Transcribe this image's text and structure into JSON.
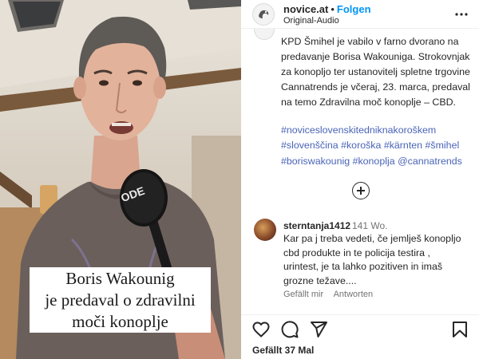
{
  "header": {
    "account": "novice.at",
    "separator": "•",
    "follow_label": "Folgen",
    "audio_label": "Original-Audio"
  },
  "post": {
    "caption": "KPD Šmihel je vabilo v farno dvorano na predavanje Borisa Wakouniga. Strokovnjak za konopljo ter ustanovitelj spletne trgovine Cannatrends je včeraj, 23. marca, predaval na temo Zdravilna moč konoplje – CBD.",
    "hashtags": [
      "#noviceslovenskitedniknakoroškem",
      "#slovenščina",
      "#koroška",
      "#kärnten",
      "#šmihel",
      "#boriswakounig",
      "#konoplja",
      "@cannatrends"
    ]
  },
  "comment": {
    "user": "sterntanja1412",
    "time": "141 Wo.",
    "text": "Kar pa j treba vedeti, če jemlješ konopljo cbd produkte in te policija testira , urintest, je ta lahko pozitiven in imaš grozne težave....",
    "like_label": "Gefällt mir",
    "reply_label": "Antworten"
  },
  "video": {
    "overlay_text": "Boris Wakounig\nje predaval o zdravilni\nmoči konoplje",
    "mic_brand": "ODE"
  },
  "actions": {
    "likes": "Gefällt 37 Mal",
    "icons": [
      "heart-icon",
      "comment-icon",
      "share-icon",
      "bookmark-icon"
    ]
  },
  "colors": {
    "link_blue": "#0095f6",
    "hashtag_blue": "#4a64b8",
    "muted": "#737373"
  }
}
